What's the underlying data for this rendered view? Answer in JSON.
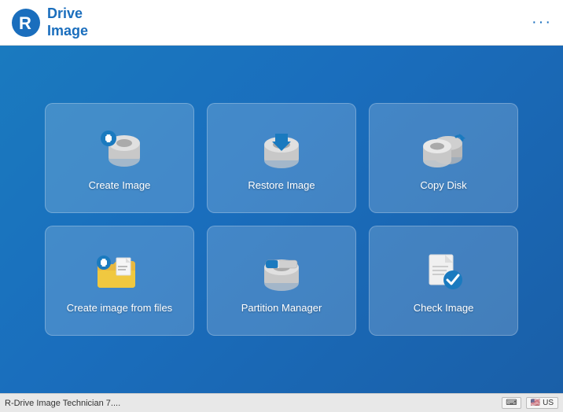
{
  "app": {
    "title": "R-Drive Image Technician 7....",
    "logo_line1": "Drive",
    "logo_line2": "Image",
    "menu_dots": "···"
  },
  "tiles": [
    {
      "id": "create-image",
      "label": "Create Image",
      "icon": "create-image-icon"
    },
    {
      "id": "restore-image",
      "label": "Restore Image",
      "icon": "restore-image-icon"
    },
    {
      "id": "copy-disk",
      "label": "Copy Disk",
      "icon": "copy-disk-icon"
    },
    {
      "id": "create-from-files",
      "label": "Create image from files",
      "icon": "create-files-icon"
    },
    {
      "id": "partition-manager",
      "label": "Partition Manager",
      "icon": "partition-manager-icon"
    },
    {
      "id": "check-image",
      "label": "Check Image",
      "icon": "check-image-icon"
    }
  ],
  "statusbar": {
    "app_name": "R-Drive Image Technician 7....",
    "kb_label": "⌨",
    "lang_label": "US"
  }
}
